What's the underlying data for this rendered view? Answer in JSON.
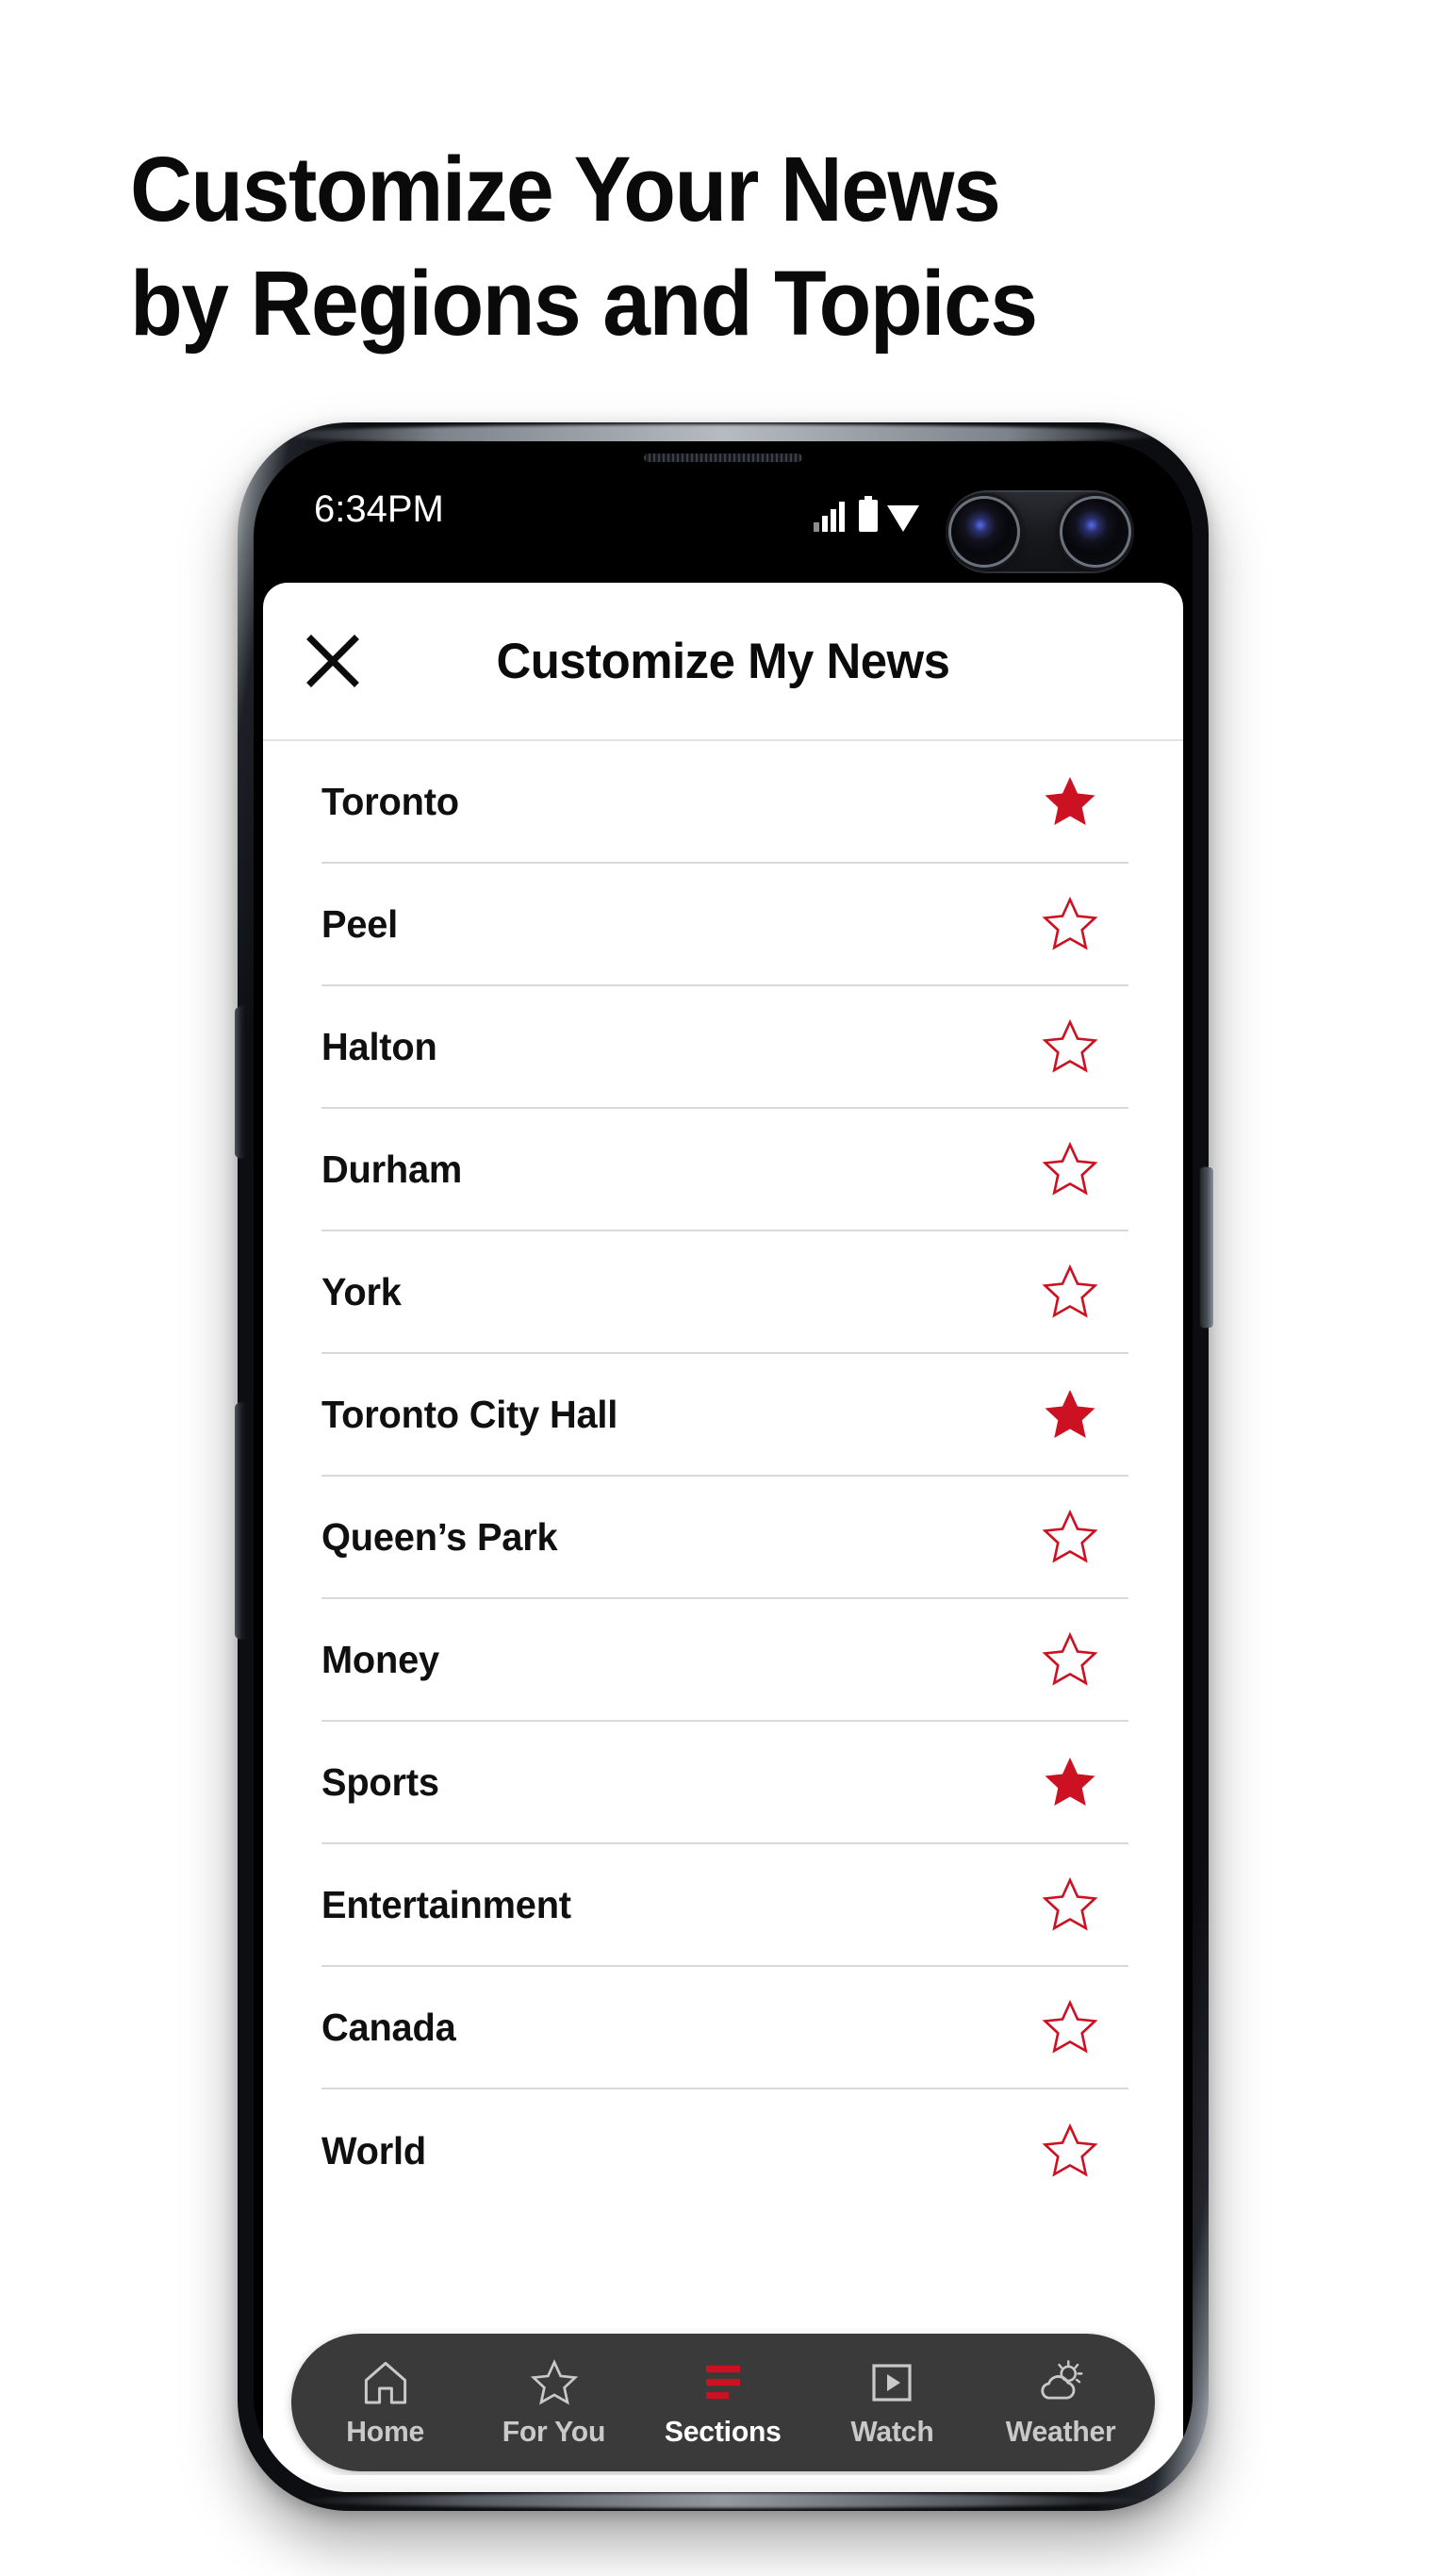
{
  "headline": {
    "line1": "Customize Your News",
    "line2": "by Regions and Topics"
  },
  "phone": {
    "statusbar": {
      "time": "6:34PM",
      "icons": [
        "signal-icon",
        "battery-icon",
        "wifi-icon"
      ],
      "camera": "dual-punch-hole-camera"
    },
    "hardware": {
      "earpiece": "speaker-grille",
      "left_buttons": [
        "bixby-button",
        "volume-rocker"
      ],
      "right_buttons": [
        "power-button"
      ]
    }
  },
  "app": {
    "header": {
      "close_icon": "close-icon",
      "title": "Customize My News"
    },
    "sections": [
      {
        "label": "Toronto",
        "starred": true
      },
      {
        "label": "Peel",
        "starred": false
      },
      {
        "label": "Halton",
        "starred": false
      },
      {
        "label": "Durham",
        "starred": false
      },
      {
        "label": "York",
        "starred": false
      },
      {
        "label": "Toronto City Hall",
        "starred": true
      },
      {
        "label": "Queen’s Park",
        "starred": false
      },
      {
        "label": "Money",
        "starred": false
      },
      {
        "label": "Sports",
        "starred": true
      },
      {
        "label": "Entertainment",
        "starred": false
      },
      {
        "label": "Canada",
        "starred": false
      },
      {
        "label": "World",
        "starred": false
      }
    ],
    "bottom_nav": [
      {
        "label": "Home",
        "icon": "home-icon",
        "active": false
      },
      {
        "label": "For You",
        "icon": "star-icon",
        "active": false
      },
      {
        "label": "Sections",
        "icon": "sections-icon",
        "active": true
      },
      {
        "label": "Watch",
        "icon": "play-icon",
        "active": false
      },
      {
        "label": "Weather",
        "icon": "weather-icon",
        "active": false
      }
    ]
  },
  "colors": {
    "brand_red": "#C8102E",
    "star_red": "#CC1122",
    "nav_bar_bg": "#3A3A3A",
    "nav_label": "#C9C9C9",
    "nav_label_active": "#FFFFFF",
    "text_primary": "#0B0B0B",
    "divider": "#D9D9D9",
    "screen_bg": "#000000",
    "sheet_bg": "#FFFFFF"
  }
}
